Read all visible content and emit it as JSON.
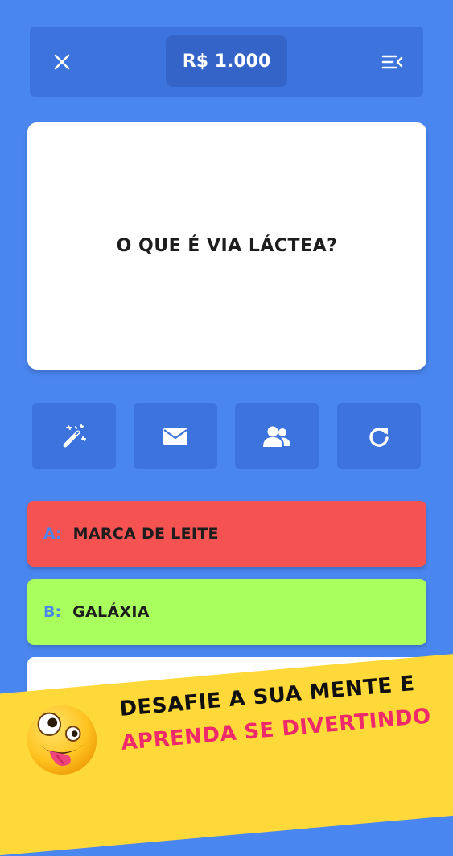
{
  "header": {
    "balance": "R$ 1.000",
    "close_icon": "close-icon",
    "menu_icon": "menu-collapse-icon"
  },
  "question": {
    "text": "O QUE É VIA LÁCTEA?"
  },
  "lifelines": [
    {
      "icon": "magic-wand-icon"
    },
    {
      "icon": "envelope-icon"
    },
    {
      "icon": "group-icon"
    },
    {
      "icon": "refresh-icon"
    }
  ],
  "answers": [
    {
      "letter": "A:",
      "text": "MARCA DE LEITE",
      "color": "#f55252"
    },
    {
      "letter": "B:",
      "text": "GALÁXIA",
      "color": "#a9ff5e"
    },
    {
      "letter": "",
      "text": "",
      "color": "#ffffff"
    }
  ],
  "promo": {
    "line1": "DESAFIE A SUA MENTE E",
    "line2": "APRENDA SE DIVERTINDO",
    "emoji_icon": "zany-face-emoji"
  },
  "colors": {
    "background": "#4a86f0",
    "panel": "#3d73dd",
    "banner": "#ffd93a",
    "promo_accent": "#ee2a6a"
  }
}
